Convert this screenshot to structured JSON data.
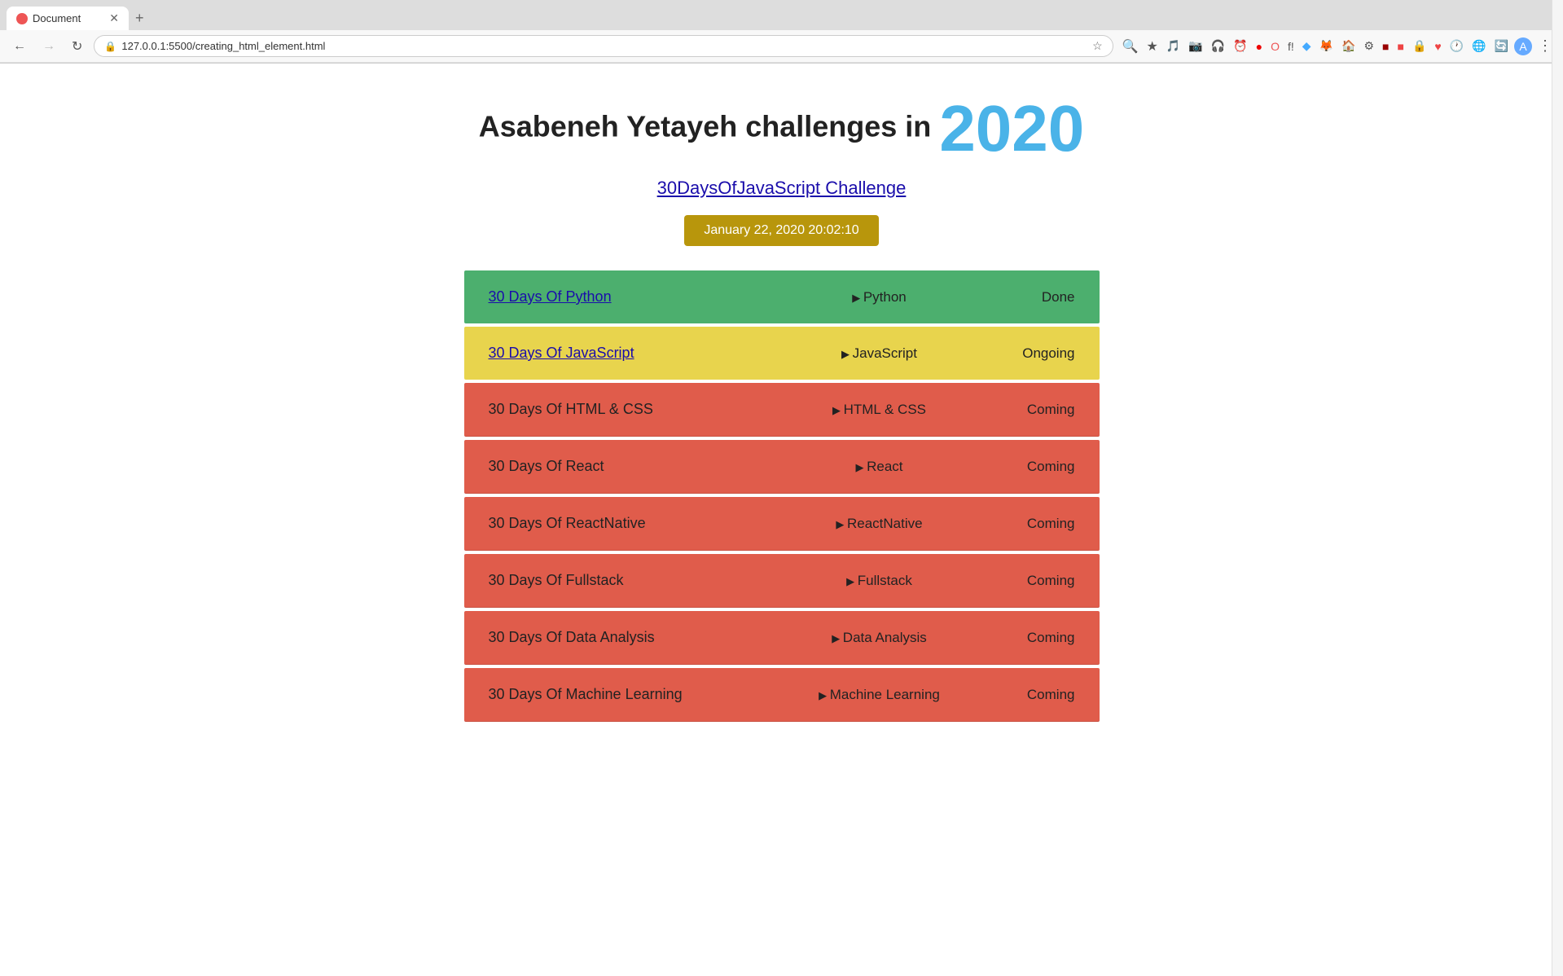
{
  "browser": {
    "tab_title": "Document",
    "url": "127.0.0.1:5500/creating_html_element.html",
    "new_tab_label": "+"
  },
  "page": {
    "main_title_text": "Asabeneh Yetayeh challenges in",
    "year": "2020",
    "challenge_link": "30DaysOfJavaScript Challenge",
    "datetime": "January 22, 2020 20:02:10",
    "challenges": [
      {
        "title": "30 Days Of Python",
        "title_link": true,
        "tech": "Python",
        "status": "Done",
        "color": "green"
      },
      {
        "title": "30 Days Of JavaScript",
        "title_link": true,
        "tech": "JavaScript",
        "status": "Ongoing",
        "color": "yellow"
      },
      {
        "title": "30 Days Of HTML & CSS",
        "title_link": false,
        "tech": "HTML & CSS",
        "status": "Coming",
        "color": "red"
      },
      {
        "title": "30 Days Of React",
        "title_link": false,
        "tech": "React",
        "status": "Coming",
        "color": "red"
      },
      {
        "title": "30 Days Of ReactNative",
        "title_link": false,
        "tech": "ReactNative",
        "status": "Coming",
        "color": "red"
      },
      {
        "title": "30 Days Of Fullstack",
        "title_link": false,
        "tech": "Fullstack",
        "status": "Coming",
        "color": "red"
      },
      {
        "title": "30 Days Of Data Analysis",
        "title_link": false,
        "tech": "Data Analysis",
        "status": "Coming",
        "color": "red"
      },
      {
        "title": "30 Days Of Machine Learning",
        "title_link": false,
        "tech": "Machine Learning",
        "status": "Coming",
        "color": "red"
      }
    ]
  }
}
